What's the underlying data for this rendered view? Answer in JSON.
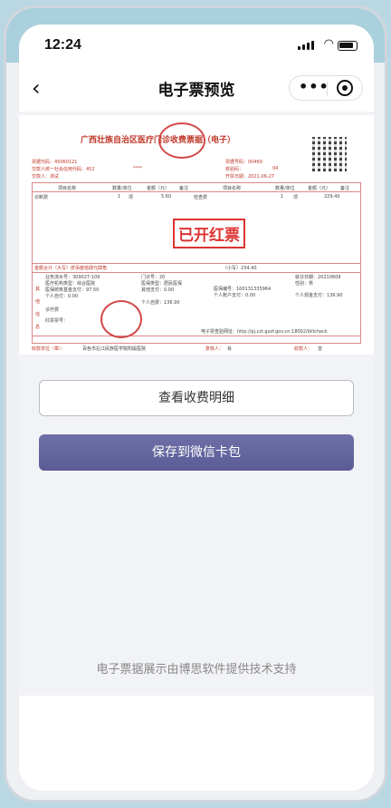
{
  "status": {
    "time": "12:24"
  },
  "nav": {
    "title": "电子票预览",
    "back_icon": "chevron-left-icon",
    "more_icon": "more-dots-icon",
    "close_icon": "target-close-icon"
  },
  "invoice": {
    "title": "广西壮族自治区医疗门诊收费票据（电子）",
    "code_label": "票据代码：45060121",
    "payer_code_label": "交款人统一社会信用代码：452",
    "payer_code_mask": "****",
    "payer_label": "交款人：测试",
    "number_label": "票据号码：00469",
    "check_label": "校验码：",
    "check_value": "04",
    "date_label": "开票日期：2021-06-27",
    "col_headers": [
      "项目名称",
      "数量/单位",
      "金额（元）",
      "备注",
      "项目名称",
      "数量/单位",
      "金额（元）",
      "备注"
    ],
    "row1": {
      "name": "诊断费",
      "qty": "1",
      "unit": "项",
      "amount": "5.60",
      "name2": "检查费",
      "qty2": "1",
      "unit2": "项",
      "amount2": "229.40"
    },
    "stamp": "已开红票",
    "total_label": "金额合计（大写）贰佰叁拾肆元肆角",
    "total_small": "（小写）234.40",
    "other_info": [
      "业务流水号：309027-109",
      "门诊号：20",
      "就诊日期：20210609",
      "医疗机构类型：综合医院",
      "医保类型：居民医保",
      "医保编号：100131335964",
      "性别：男",
      "医保统筹基金支付：97.50",
      "其他支付：0.00",
      "个人账户支付：0.00",
      "个人现金支付：136.90",
      "个人自付：0.00",
      "个人自费：136.90",
      "诊疗费"
    ],
    "side_label": "其他信息",
    "red_ticket_label": "红票票号：",
    "query_label": "电子票查验网址：http://pj.czt.gxzf.gov.cn:18002/billcheck",
    "payee_label": "收款单位（章）：",
    "payee_name": "百色市右江民族医学院附属医院",
    "reviewer_label": "复核人：",
    "reviewer_name": "肖",
    "collector_label": "收款人：",
    "collector_name": "曾"
  },
  "actions": {
    "detail_button": "查看收费明细",
    "save_button": "保存到微信卡包"
  },
  "footer": {
    "text": "电子票据展示由博思软件提供技术支持"
  },
  "colors": {
    "accent": "#5b5b96",
    "stamp_red": "#d33333"
  }
}
